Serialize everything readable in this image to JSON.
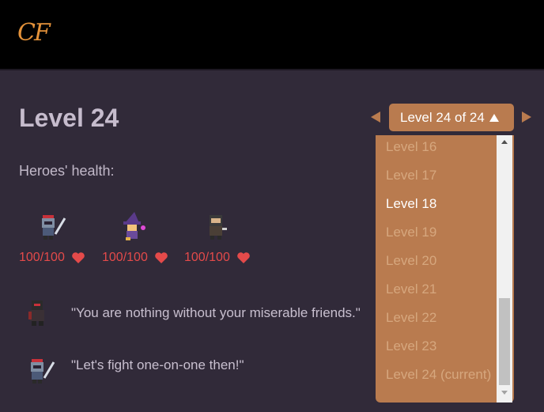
{
  "header": {
    "logo_text": "CF"
  },
  "level": {
    "title": "Level 24",
    "selector_label": "Level 24 of 24",
    "dropdown_options": [
      "Level 16",
      "Level 17",
      "Level 18",
      "Level 19",
      "Level 20",
      "Level 21",
      "Level 22",
      "Level 23",
      "Level 24 (current)"
    ],
    "highlighted_option": "Level 18"
  },
  "heroes": {
    "label": "Heroes' health:",
    "list": [
      {
        "icon": "knight-icon",
        "health": "100/100"
      },
      {
        "icon": "wizard-icon",
        "health": "100/100"
      },
      {
        "icon": "rogue-icon",
        "health": "100/100"
      }
    ]
  },
  "dialog": [
    {
      "speaker_icon": "dark-knight-icon",
      "text": "\"You are nothing without your miserable friends.\""
    },
    {
      "speaker_icon": "knight-icon",
      "text": "\"Let's fight one-on-one then!\""
    }
  ],
  "colors": {
    "background": "#312a39",
    "topbar": "#000000",
    "accent": "#b97b4f",
    "health": "#e44a4a",
    "logo": "#e4923a"
  }
}
